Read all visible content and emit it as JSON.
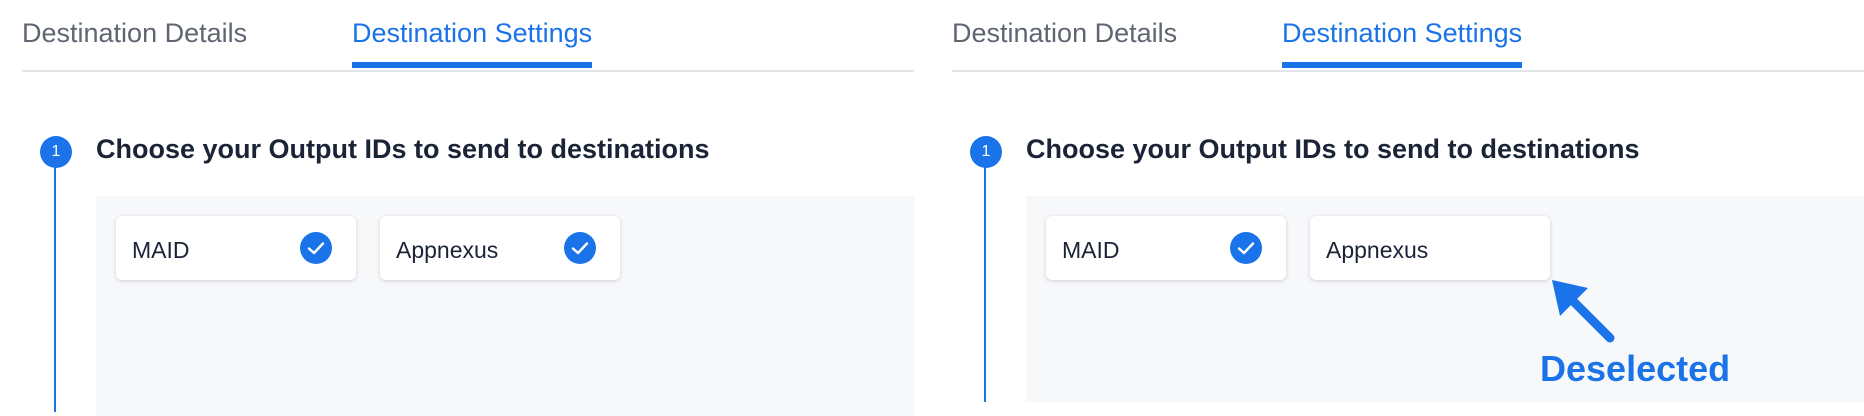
{
  "panels": [
    {
      "tabs": [
        {
          "label": "Destination Details",
          "active": false
        },
        {
          "label": "Destination Settings",
          "active": true
        }
      ],
      "step": {
        "number": "1",
        "title": "Choose your Output IDs to send to destinations"
      },
      "output_ids": [
        {
          "label": "MAID",
          "selected": true
        },
        {
          "label": "Appnexus",
          "selected": true
        }
      ]
    },
    {
      "tabs": [
        {
          "label": "Destination Details",
          "active": false
        },
        {
          "label": "Destination Settings",
          "active": true
        }
      ],
      "step": {
        "number": "1",
        "title": "Choose your Output IDs to send to destinations"
      },
      "output_ids": [
        {
          "label": "MAID",
          "selected": true
        },
        {
          "label": "Appnexus",
          "selected": false
        }
      ]
    }
  ],
  "annotation": {
    "text": "Deselected",
    "color": "#1a73e8"
  },
  "colors": {
    "accent": "#1a73e8",
    "text": "#1b2336",
    "muted": "#5f6672"
  }
}
